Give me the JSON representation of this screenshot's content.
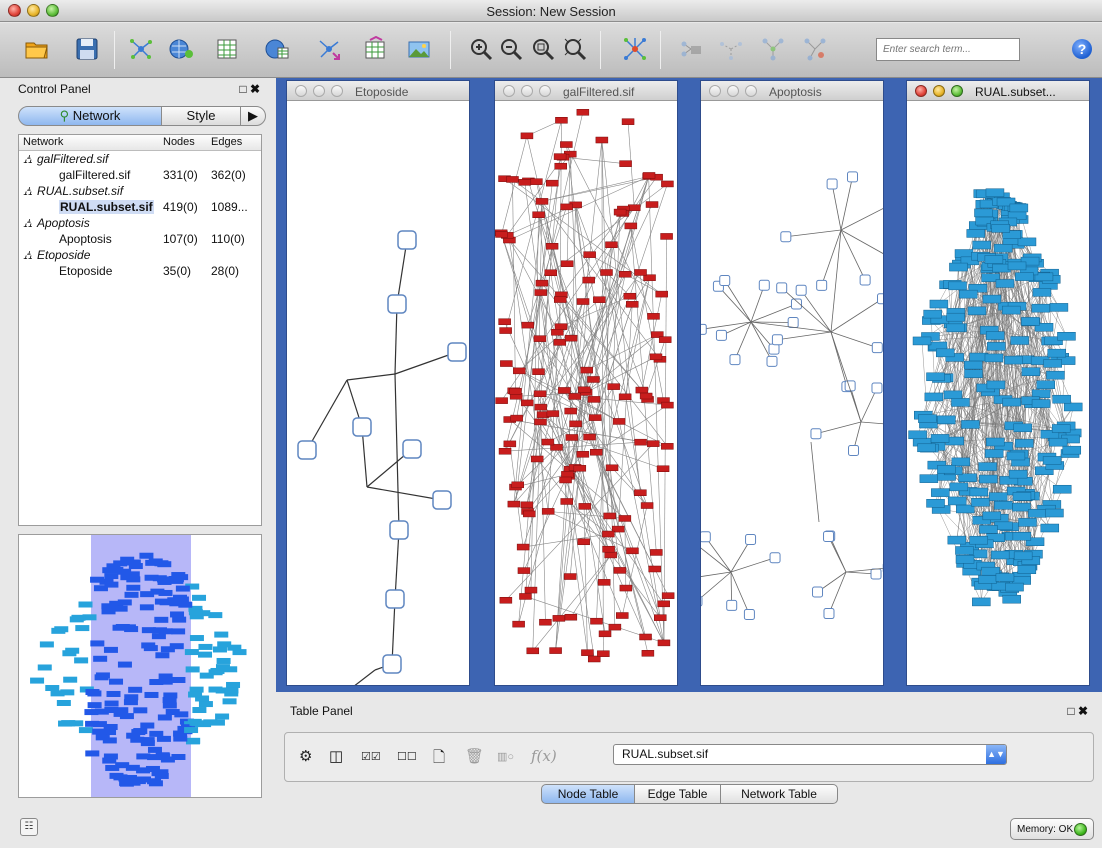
{
  "window": {
    "title": "Session: New Session"
  },
  "toolbar": {
    "search_placeholder": "Enter search term...",
    "buttons": [
      "open-session",
      "save-session",
      "import-network-file",
      "import-network-url",
      "import-table-file",
      "import-table-url",
      "export-network",
      "export-table",
      "export-image",
      "zoom-in",
      "zoom-out",
      "zoom-selected",
      "zoom-fit",
      "layout",
      "first-neighbors",
      "hide-selected",
      "show-all",
      "hide-nodes",
      "help"
    ]
  },
  "control_panel": {
    "title": "Control Panel",
    "tabs": {
      "network": "Network",
      "style": "Style",
      "more": "▶"
    },
    "columns": {
      "network": "Network",
      "nodes": "Nodes",
      "edges": "Edges"
    },
    "rows": [
      {
        "name": "galFiltered.sif",
        "nodes": "",
        "edges": ""
      },
      {
        "name": "galFiltered.sif",
        "nodes": "331(0)",
        "edges": "362(0)"
      },
      {
        "name": "RUAL.subset.sif",
        "nodes": "",
        "edges": ""
      },
      {
        "name": "RUAL.subset.sif",
        "nodes": "419(0)",
        "edges": "1089..."
      },
      {
        "name": "Apoptosis",
        "nodes": "",
        "edges": ""
      },
      {
        "name": "Apoptosis",
        "nodes": "107(0)",
        "edges": "110(0)"
      },
      {
        "name": "Etoposide",
        "nodes": "",
        "edges": ""
      },
      {
        "name": "Etoposide",
        "nodes": "35(0)",
        "edges": "28(0)"
      }
    ]
  },
  "network_windows": [
    {
      "title": "Etoposide",
      "active": false
    },
    {
      "title": "galFiltered.sif",
      "active": false
    },
    {
      "title": "Apoptosis",
      "active": false
    },
    {
      "title": "RUAL.subset...",
      "active": true
    }
  ],
  "table_panel": {
    "title": "Table Panel",
    "selected_network": "RUAL.subset.sif",
    "function_label": "f(x)",
    "tabs": {
      "node": "Node Table",
      "edge": "Edge Table",
      "network": "Network Table"
    }
  },
  "status": {
    "memory": "Memory: OK"
  },
  "colors": {
    "accent": "#3d64b2",
    "node_red": "#c81d1d",
    "node_blue": "#2b9ad6",
    "node_outline": "#5f86c0"
  }
}
